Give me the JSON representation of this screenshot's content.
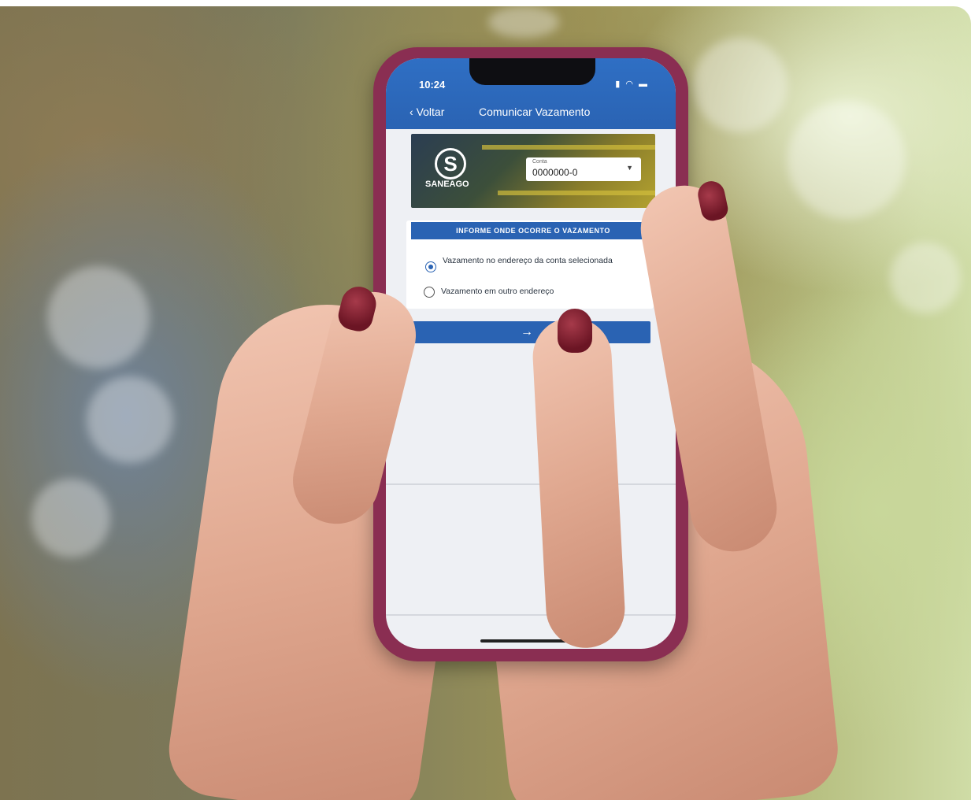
{
  "app": {
    "status_time": "10:24",
    "back_label": "Voltar",
    "title": "Comunicar Vazamento"
  },
  "banner": {
    "logo_text": "SANEAGO",
    "account_label": "Conta",
    "account_value": "0000000-0"
  },
  "form": {
    "header": "INFORME ONDE OCORRE O VAZAMENTO",
    "options": [
      {
        "label": "Vazamento no endereço da conta selecionada",
        "selected": true
      },
      {
        "label": "Vazamento em outro endereço",
        "selected": false
      }
    ],
    "next_glyph": "→"
  },
  "colors": {
    "primary": "#2a63b3",
    "phone_case": "#8a2e52",
    "nail_polish": "#6b1524"
  }
}
